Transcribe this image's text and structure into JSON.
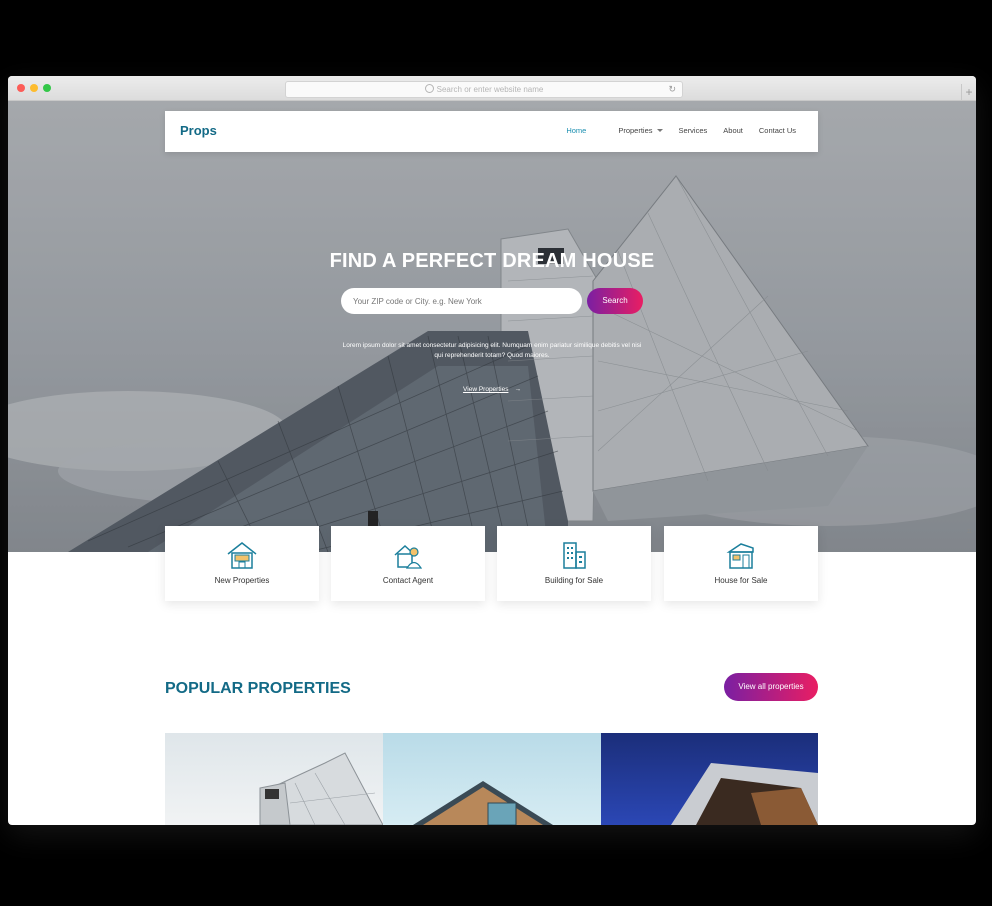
{
  "browser": {
    "address_placeholder": "Search or enter website name",
    "reload_icon": "↻",
    "newtab_icon": "+"
  },
  "nav": {
    "brand": "Props",
    "items": [
      {
        "label": "Home",
        "active": true
      },
      {
        "label": "Properties",
        "has_dropdown": true
      },
      {
        "label": "Services"
      },
      {
        "label": "About"
      },
      {
        "label": "Contact Us"
      }
    ]
  },
  "hero": {
    "title": "FIND A PERFECT DREAM HOUSE",
    "search_placeholder": "Your ZIP code or City. e.g. New York",
    "search_button": "Search",
    "description": "Lorem ipsum dolor sit amet consectetur adipisicing elit. Numquam enim pariatur similique debitis vel nisi qui reprehenderit totam? Quod maiores.",
    "link_label": "View Properties",
    "link_arrow": "→"
  },
  "features": [
    {
      "label": "New Properties",
      "icon": "new-house-icon"
    },
    {
      "label": "Contact Agent",
      "icon": "agent-icon"
    },
    {
      "label": "Building for Sale",
      "icon": "building-icon"
    },
    {
      "label": "House for Sale",
      "icon": "house-icon"
    }
  ],
  "popular": {
    "title": "POPULAR PROPERTIES",
    "button": "View all properties"
  },
  "colors": {
    "brand": "#136a86",
    "accent_start": "#7a1fa2",
    "accent_end": "#e91e63"
  }
}
